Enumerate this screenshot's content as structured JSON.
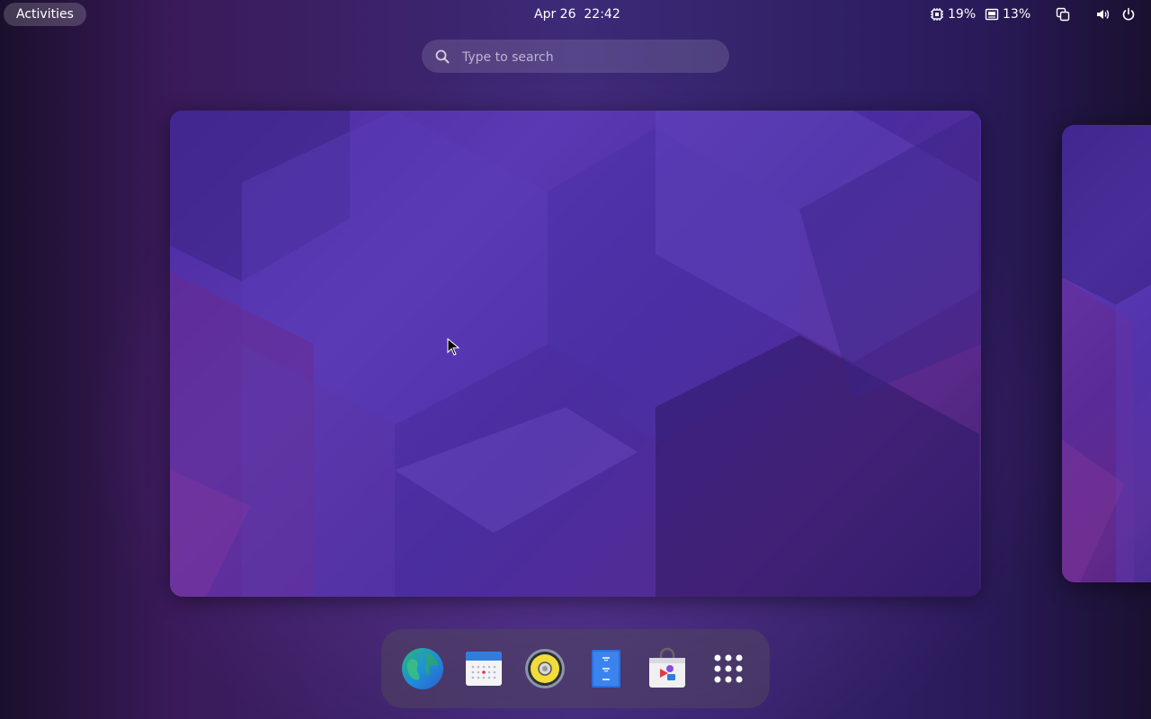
{
  "topbar": {
    "activities_label": "Activities",
    "clock": "Apr 26  22:42",
    "cpu": {
      "icon": "cpu-icon",
      "value": "19%"
    },
    "memory": {
      "icon": "memory-icon",
      "value": "13%"
    },
    "status_icons": [
      "window-switcher-icon",
      "volume-icon",
      "power-icon"
    ]
  },
  "search": {
    "placeholder": "Type to search",
    "value": ""
  },
  "workspaces": {
    "count_visible": 2,
    "wallpaper": {
      "colors": [
        "#4b2a9e",
        "#5b39b4",
        "#5a2a8a",
        "#3a1f6e"
      ]
    }
  },
  "dock": {
    "items": [
      {
        "name": "web-browser",
        "icon": "globe-icon"
      },
      {
        "name": "calendar",
        "icon": "calendar-icon"
      },
      {
        "name": "music-player",
        "icon": "speaker-icon"
      },
      {
        "name": "text-editor",
        "icon": "text-editor-icon"
      },
      {
        "name": "software-store",
        "icon": "shopping-bag-icon"
      },
      {
        "name": "show-applications",
        "icon": "app-grid-icon"
      }
    ]
  },
  "colors": {
    "accent": "#ffffff",
    "topbar_text": "#ffffff",
    "dock_bg": "#50465f"
  }
}
